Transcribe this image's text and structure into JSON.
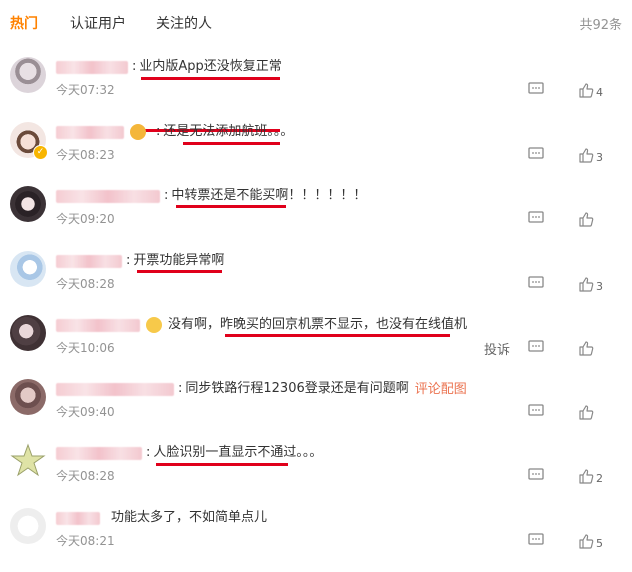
{
  "tabs": [
    {
      "label": "热门",
      "active": true
    },
    {
      "label": "认证用户",
      "active": false
    },
    {
      "label": "关注的人",
      "active": false
    }
  ],
  "total_label": "共92条",
  "accent_color": "#ff8200",
  "underline_color": "#e0001b",
  "comments": [
    {
      "text": "业内版App还没恢复正常",
      "time": "今天07:32",
      "likes": "4"
    },
    {
      "text": "还是无法添加航班。。。",
      "time": "今天08:23",
      "likes": "3"
    },
    {
      "text": "中转票还是不能买啊！！！！！！",
      "time": "今天09:20",
      "likes": ""
    },
    {
      "text": "开票功能异常啊",
      "time": "今天08:28",
      "likes": "3"
    },
    {
      "text": "没有啊，昨晚买的回京机票不显示，也没有在线值机",
      "time": "今天10:06",
      "likes": "",
      "report_label": "投诉"
    },
    {
      "text": "同步铁路行程12306登录还是有问题啊",
      "link": "评论配图",
      "time": "今天09:40",
      "likes": ""
    },
    {
      "text": "人脸识别一直显示不通过。。。",
      "time": "今天08:28",
      "likes": "2"
    },
    {
      "text": "功能太多了，不如简单点儿",
      "time": "今天08:21",
      "likes": "5"
    }
  ]
}
